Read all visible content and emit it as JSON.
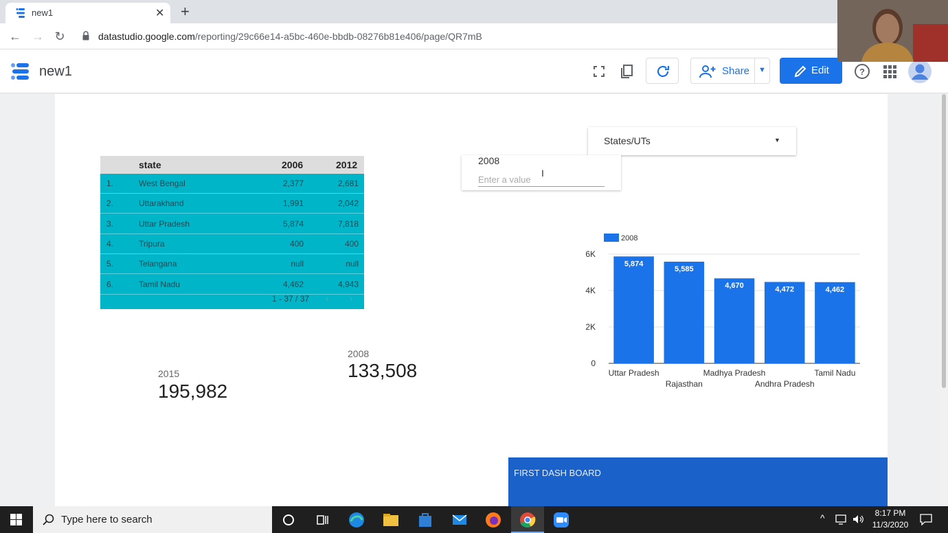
{
  "browser": {
    "tab_title": "new1",
    "url_host": "datastudio.google.com",
    "url_path": "/reporting/29c66e14-a5bc-460e-bbdb-08276b81e406/page/QR7mB"
  },
  "header": {
    "report_name": "new1",
    "share_label": "Share",
    "edit_label": "Edit"
  },
  "table": {
    "columns": [
      "state",
      "2006",
      "2012"
    ],
    "rows": [
      {
        "num": "1.",
        "state": "West Bengal",
        "v2006": "2,377",
        "v2012": "2,681"
      },
      {
        "num": "2.",
        "state": "Uttarakhand",
        "v2006": "1,991",
        "v2012": "2,042"
      },
      {
        "num": "3.",
        "state": "Uttar Pradesh",
        "v2006": "5,874",
        "v2012": "7,818"
      },
      {
        "num": "4.",
        "state": "Tripura",
        "v2006": "400",
        "v2012": "400"
      },
      {
        "num": "5.",
        "state": "Telangana",
        "v2006": "null",
        "v2012": "null"
      },
      {
        "num": "6.",
        "state": "Tamil Nadu",
        "v2006": "4,462",
        "v2012": "4,943"
      }
    ],
    "pagination": "1 - 37 / 37"
  },
  "scorecards": [
    {
      "label": "2015",
      "value": "195,982"
    },
    {
      "label": "2008",
      "value": "133,508"
    }
  ],
  "filters": {
    "dropdown_label": "States/UTs",
    "input_label": "2008",
    "input_placeholder": "Enter a value"
  },
  "chart_data": {
    "type": "bar",
    "categories": [
      "Uttar Pradesh",
      "Rajasthan",
      "Madhya Pradesh",
      "Andhra Pradesh",
      "Tamil Nadu"
    ],
    "series": [
      {
        "name": "2008",
        "values": [
          5874,
          5585,
          4670,
          4472,
          4462
        ],
        "labels": [
          "5,874",
          "5,585",
          "4,670",
          "4,472",
          "4,462"
        ]
      }
    ],
    "y_ticks": [
      "0",
      "2K",
      "4K",
      "6K"
    ],
    "ylim": [
      0,
      6000
    ],
    "legend": "top-left",
    "grid": true,
    "bar_color": "#1a73e8"
  },
  "textbox": {
    "text": "FIRST DASH BOARD"
  },
  "taskbar": {
    "search_placeholder": "Type here to search",
    "time": "8:17 PM",
    "date": "11/3/2020"
  }
}
